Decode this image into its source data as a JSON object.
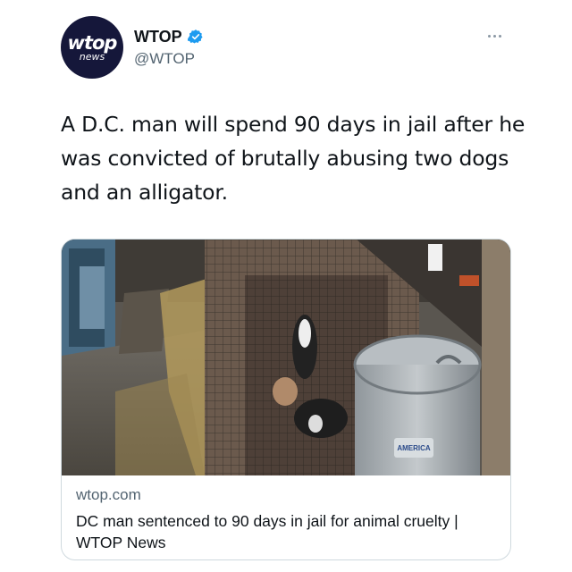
{
  "account": {
    "avatar_logo_main": "wtop",
    "avatar_logo_sub": "news",
    "display_name": "WTOP",
    "handle": "@WTOP",
    "verified_icon": "verified-badge-icon",
    "verified_color": "#1d9bf0"
  },
  "tweet": {
    "text": "A D.C. man will spend 90 days in jail after he was convicted of brutally abusing two dogs and an alligator."
  },
  "link_card": {
    "image_description_icon": "photo-dogs-in-cage",
    "domain": "wtop.com",
    "title": "DC man sentenced to 90 days in jail for animal cruelty | WTOP News",
    "can_label": "AMERICA"
  },
  "colors": {
    "text_primary": "#0f1419",
    "text_secondary": "#536471",
    "border": "#cfd9de",
    "avatar_bg": "#15173a"
  }
}
